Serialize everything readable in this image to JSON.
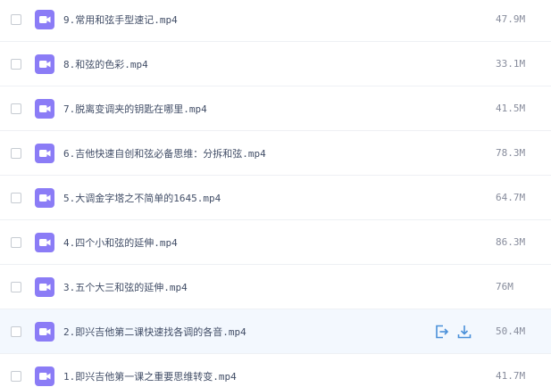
{
  "files": [
    {
      "name": "9.常用和弦手型速记.mp4",
      "size": "47.9M"
    },
    {
      "name": "8.和弦的色彩.mp4",
      "size": "33.1M"
    },
    {
      "name": "7.脱离变调夹的钥匙在哪里.mp4",
      "size": "41.5M"
    },
    {
      "name": "6.吉他快速自创和弦必备思维：分拆和弦.mp4",
      "size": "78.3M"
    },
    {
      "name": "5.大调金字塔之不简单的1645.mp4",
      "size": "64.7M"
    },
    {
      "name": "4.四个小和弦的延伸.mp4",
      "size": "86.3M"
    },
    {
      "name": "3.五个大三和弦的延伸.mp4",
      "size": "76M"
    },
    {
      "name": "2.即兴吉他第二课快速找各调的各音.mp4",
      "size": "50.4M",
      "hovered": true
    },
    {
      "name": "1.即兴吉他第一课之重要思维转变.mp4",
      "size": "41.7M"
    }
  ],
  "colors": {
    "icon_bg": "#8b7cf6",
    "action": "#4a90d9",
    "hover_row": "#f3f8fe"
  },
  "icons": {
    "file": "video-file-icon",
    "share": "share-icon",
    "download": "download-icon"
  }
}
